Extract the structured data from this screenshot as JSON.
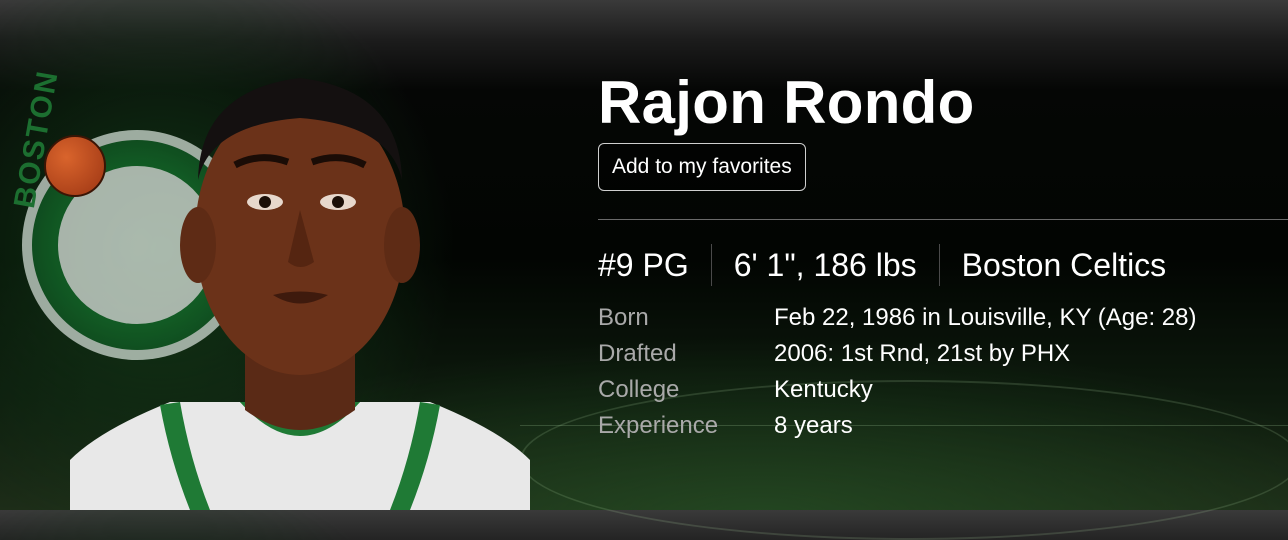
{
  "player": {
    "name": "Rajon Rondo",
    "favorite_button": "Add to my favorites",
    "meta": {
      "number_position": "#9 PG",
      "height_weight": "6' 1\", 186 lbs",
      "team": "Boston Celtics"
    },
    "details": [
      {
        "label": "Born",
        "value": "Feb 22, 1986 in Louisville, KY (Age: 28)"
      },
      {
        "label": "Drafted",
        "value": "2006: 1st Rnd, 21st by PHX"
      },
      {
        "label": "College",
        "value": "Kentucky"
      },
      {
        "label": "Experience",
        "value": "8 years"
      }
    ]
  },
  "team_logo": {
    "wordmark": "BOSTON",
    "colors": {
      "green": "#136a2a",
      "ball": "#d9642c",
      "ring": "#f0f0f0"
    }
  },
  "theme": {
    "text": "#ffffff",
    "label": "#a9a9a9",
    "background": "#020502"
  }
}
